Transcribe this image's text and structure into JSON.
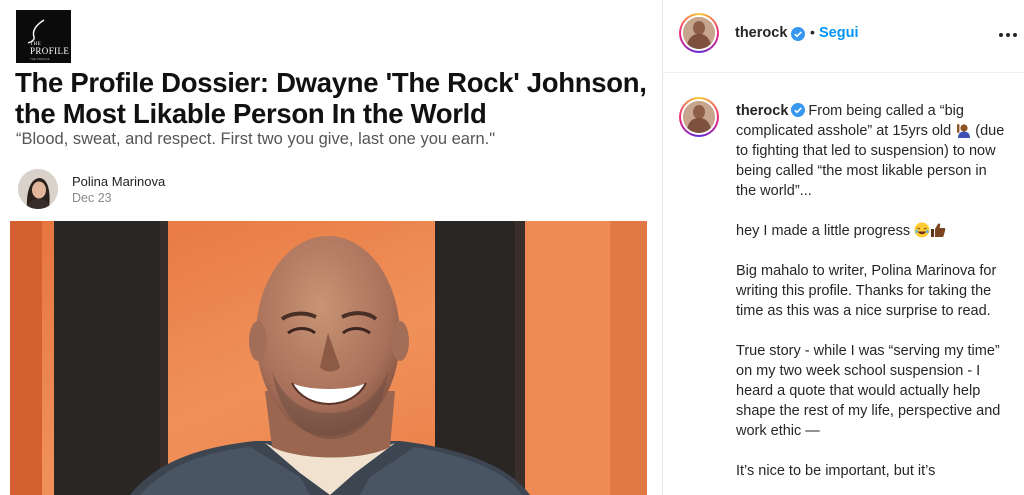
{
  "article": {
    "logo": {
      "line1": "THE",
      "line2": "PROFILE",
      "line3": "THE PROFILE"
    },
    "title": "The Profile Dossier: Dwayne 'The Rock' Johnson, the Most Likable Person In the World",
    "subtitle": "“Blood, sweat, and respect. First two you give, last one you earn.\"",
    "author": "Polina Marinova",
    "date": "Dec 23",
    "hero_icon": "portrait-photo"
  },
  "instagram": {
    "username": "therock",
    "separator": "•",
    "follow_label": "Segui",
    "more_icon": "more-options-icon",
    "verified_color": "#3897f0",
    "follow_color": "#0095f6",
    "caption": {
      "username": "therock",
      "p1": "From being called a “big complicated asshole” at 15yrs old",
      "p1b": "(due to fighting that led to suspension) to now being called “the most likable person in the world”...",
      "p2": "hey I made a little progress",
      "p3": "Big mahalo to writer, Polina Marinova for writing this profile. Thanks for taking the time as this was a nice surprise to read.",
      "p4": "True story - while I was “serving my time” on my two week school suspension - I heard a quote that would actually help shape the rest of my life, perspective and work ethic —",
      "p5": "It’s nice to be important, but it’s"
    }
  }
}
